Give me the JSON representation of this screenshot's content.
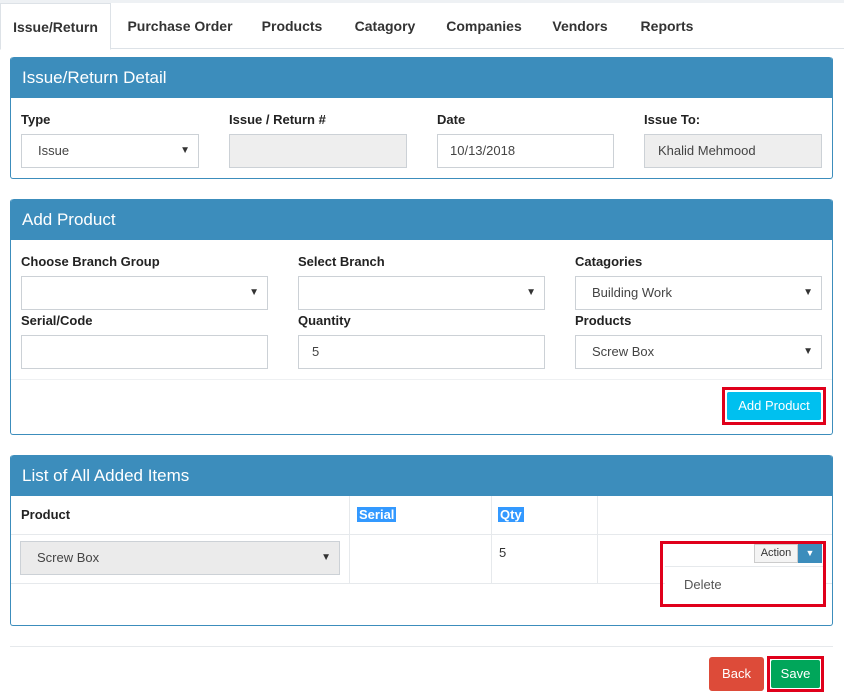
{
  "tabs": [
    {
      "label": "Issue/Return",
      "active": true
    },
    {
      "label": "Purchase Order",
      "active": false
    },
    {
      "label": "Products",
      "active": false
    },
    {
      "label": "Catagory",
      "active": false
    },
    {
      "label": "Companies",
      "active": false
    },
    {
      "label": "Vendors",
      "active": false
    },
    {
      "label": "Reports",
      "active": false
    }
  ],
  "detail": {
    "title": "Issue/Return Detail",
    "type_label": "Type",
    "type_value": "Issue",
    "number_label": "Issue / Return #",
    "number_value": "",
    "date_label": "Date",
    "date_value": "10/13/2018",
    "issue_to_label": "Issue To:",
    "issue_to_value": "Khalid Mehmood"
  },
  "add_product": {
    "title": "Add Product",
    "branch_group_label": "Choose Branch Group",
    "branch_group_value": "",
    "branch_label": "Select Branch",
    "branch_value": "",
    "categories_label": "Catagories",
    "categories_value": "Building Work",
    "serial_label": "Serial/Code",
    "serial_value": "",
    "quantity_label": "Quantity",
    "quantity_value": "5",
    "products_label": "Products",
    "products_value": "Screw Box",
    "add_button": "Add Product"
  },
  "items": {
    "title": "List of All Added Items",
    "columns": [
      "Product",
      "Serial",
      "Qty"
    ],
    "rows": [
      {
        "product": "Screw Box",
        "serial": "",
        "qty": "5"
      }
    ],
    "action_label": "Action",
    "action_menu": [
      "Delete"
    ]
  },
  "footer": {
    "back": "Back",
    "save": "Save"
  },
  "colors": {
    "panel_header": "#3c8dbc",
    "add_button": "#00c0ef",
    "back_button": "#dd4b39",
    "save_button": "#00a65a",
    "highlight_box": "#e0001b",
    "selection": "#3399ff"
  }
}
